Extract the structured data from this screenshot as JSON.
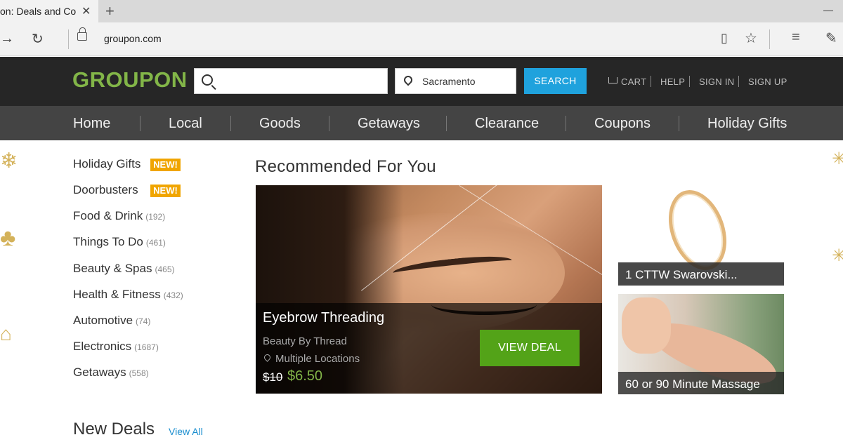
{
  "browser": {
    "tab_title": "on: Deals and Cou",
    "address": "groupon.com"
  },
  "header": {
    "logo": "GROUPON",
    "search_placeholder": "",
    "location": "Sacramento",
    "search_button": "SEARCH",
    "links": [
      "CART",
      "HELP",
      "SIGN IN",
      "SIGN UP"
    ]
  },
  "nav": {
    "items": [
      "Home",
      "Local",
      "Goods",
      "Getaways",
      "Clearance",
      "Coupons",
      "Holiday Gifts"
    ]
  },
  "sidebar": {
    "items": [
      {
        "label": "Holiday Gifts",
        "badge": "NEW!"
      },
      {
        "label": "Doorbusters",
        "badge": "NEW!"
      },
      {
        "label": "Food & Drink",
        "count": "(192)"
      },
      {
        "label": "Things To Do",
        "count": "(461)"
      },
      {
        "label": "Beauty & Spas",
        "count": "(465)"
      },
      {
        "label": "Health & Fitness",
        "count": "(432)"
      },
      {
        "label": "Automotive",
        "count": "(74)"
      },
      {
        "label": "Electronics",
        "count": "(1687)"
      },
      {
        "label": "Getaways",
        "count": "(558)"
      }
    ]
  },
  "main": {
    "recommended_title": "Recommended For You",
    "featured": {
      "title": "Eyebrow Threading",
      "merchant": "Beauty By Thread",
      "location": "Multiple Locations",
      "old_price": "$10",
      "new_price": "$6.50",
      "button": "VIEW DEAL"
    },
    "cards": [
      {
        "title": "1 CTTW Swarovski..."
      },
      {
        "title": "60 or 90 Minute Massage"
      }
    ],
    "new_deals_title": "New Deals",
    "view_all": "View All"
  },
  "colors": {
    "brand_green": "#82b548",
    "search_blue": "#1fa2dd",
    "badge_orange": "#f0a500",
    "cta_green": "#53a318"
  }
}
